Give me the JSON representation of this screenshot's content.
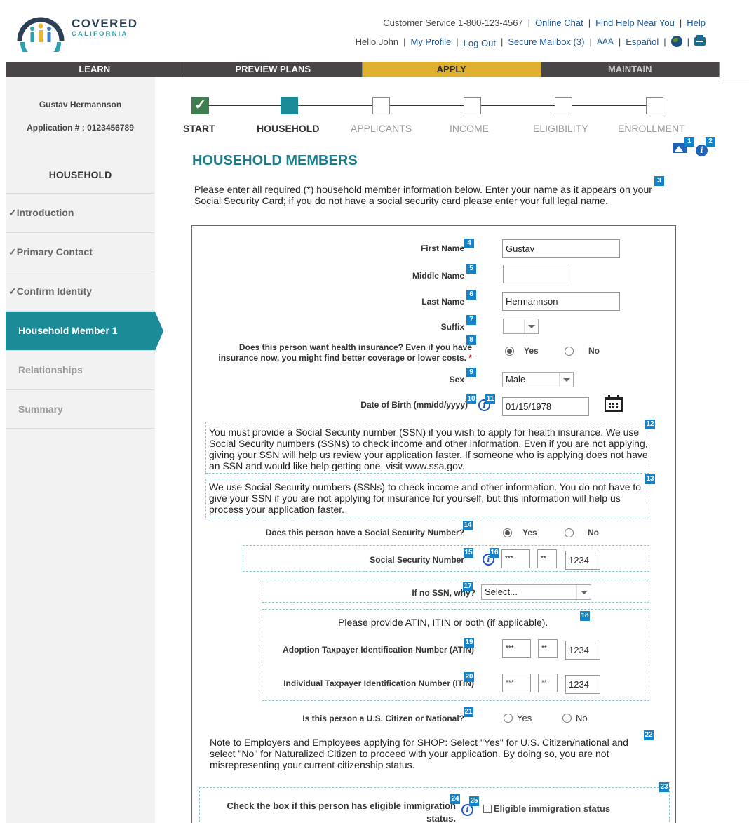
{
  "brand": {
    "line1": "COVERED",
    "line2": "CALIFORNIA"
  },
  "utility": {
    "customer_service": "Customer Service 1-800-123-4567",
    "online_chat": "Online Chat",
    "find_help": "Find Help Near You",
    "help": "Help",
    "greeting": "Hello John",
    "my_profile": "My Profile",
    "log_out": "Log Out",
    "secure_mailbox": "Secure Mailbox (3)",
    "text_size": "AAA",
    "language": "Español"
  },
  "nav": [
    "LEARN",
    "PREVIEW PLANS",
    "APPLY",
    "MAINTAIN"
  ],
  "sidebar": {
    "name": "Gustav Hermannson",
    "application": "Application # : 0123456789",
    "section": "HOUSEHOLD",
    "items": [
      {
        "label": "Introduction",
        "state": "done"
      },
      {
        "label": "Primary Contact",
        "state": "done"
      },
      {
        "label": "Confirm Identity",
        "state": "done"
      },
      {
        "label": "Household Member 1",
        "state": "active"
      },
      {
        "label": "Relationships",
        "state": "disabled"
      },
      {
        "label": "Summary",
        "state": "disabled"
      }
    ],
    "check": "✓"
  },
  "progress": {
    "steps": [
      "START",
      "HOUSEHOLD",
      "APPLICANTS",
      "INCOME",
      "ELIGIBILITY",
      "ENROLLMENT"
    ],
    "check": "✓"
  },
  "badges": [
    "1",
    "2",
    "3",
    "4",
    "5",
    "6",
    "7",
    "8",
    "9",
    "10",
    "11",
    "12",
    "13",
    "14",
    "15",
    "16",
    "17",
    "18",
    "19",
    "20",
    "21",
    "22",
    "23",
    "24",
    "25"
  ],
  "page": {
    "title": "HOUSEHOLD MEMBERS",
    "intro": "Please enter all required (*) household member information below.  Enter your name as it appears on your Social Security Card; if you do not have a social security card please enter your full legal name."
  },
  "form": {
    "first_name_label": "First Name",
    "first_name_value": "Gustav",
    "middle_name_label": "Middle Name",
    "middle_name_value": "",
    "last_name_label": "Last Name",
    "last_name_value": "Hermannson",
    "suffix_label": "Suffix",
    "suffix_value": "",
    "insurance_q": "Does this person want health insurance? Even if you have insurance now, you might find better coverage or lower costs.",
    "required_mark": "*",
    "yes": "Yes",
    "no": "No",
    "sex_label": "Sex",
    "sex_value": "Male",
    "dob_label": "Date of Birth (mm/dd/yyyy)",
    "dob_value": "01/15/1978",
    "info_glyph": "i",
    "ssn_para1": "You must provide a Social Security number (SSN) if you wish to apply for health insurance. We use Social Security numbers (SSNs) to check income and other information. Even if you are not applying, giving your SSN will help us review your application faster. If someone who is applying does not have an SSN and would like help getting one, visit www.ssa.gov.",
    "ssn_para2": "We use Social Security numbers (SSNs) to check income and other information. You do not have to give your SSN if you are not applying for insurance for yourself, but this information will help us process your application faster.",
    "has_ssn_q": "Does this person have a Social Security Number?",
    "ssn_label": "Social Security Number",
    "ssn_part1": "***",
    "ssn_part2": "**",
    "ssn_part3": "1234",
    "no_ssn_label": "If no SSN, why?",
    "no_ssn_value": "Select...",
    "atin_itin_note": "Please provide ATIN, ITIN or both (if applicable).",
    "atin_label": "Adoption Taxpayer Identification Number (ATIN)",
    "atin_part1": "***",
    "atin_part2": "**",
    "atin_part3": "1234",
    "itin_label": "Individual Taxpayer Identification Number (ITIN)",
    "itin_part1": "***",
    "itin_part2": "**",
    "itin_part3": "1234",
    "citizen_q": "Is this person a U.S. Citizen or National?",
    "shop_note": "Note to Employers and Employees applying for SHOP: Select \"Yes\" for U.S. Citizen/national and select \"No\" for Naturalized Citizen to proceed with your application.  By doing so, you are not misrepresenting your current citizenship status.",
    "immigration_q": "Check the box if this person has eligible immigration status.",
    "immigration_checkbox": "Eligible immigration status"
  },
  "colors": {
    "teal": "#1c8b98",
    "gold": "#dfb02d",
    "nav_dark": "#4a4647",
    "badge_blue": "#1384cc",
    "title_teal": "#1c7c8a"
  }
}
